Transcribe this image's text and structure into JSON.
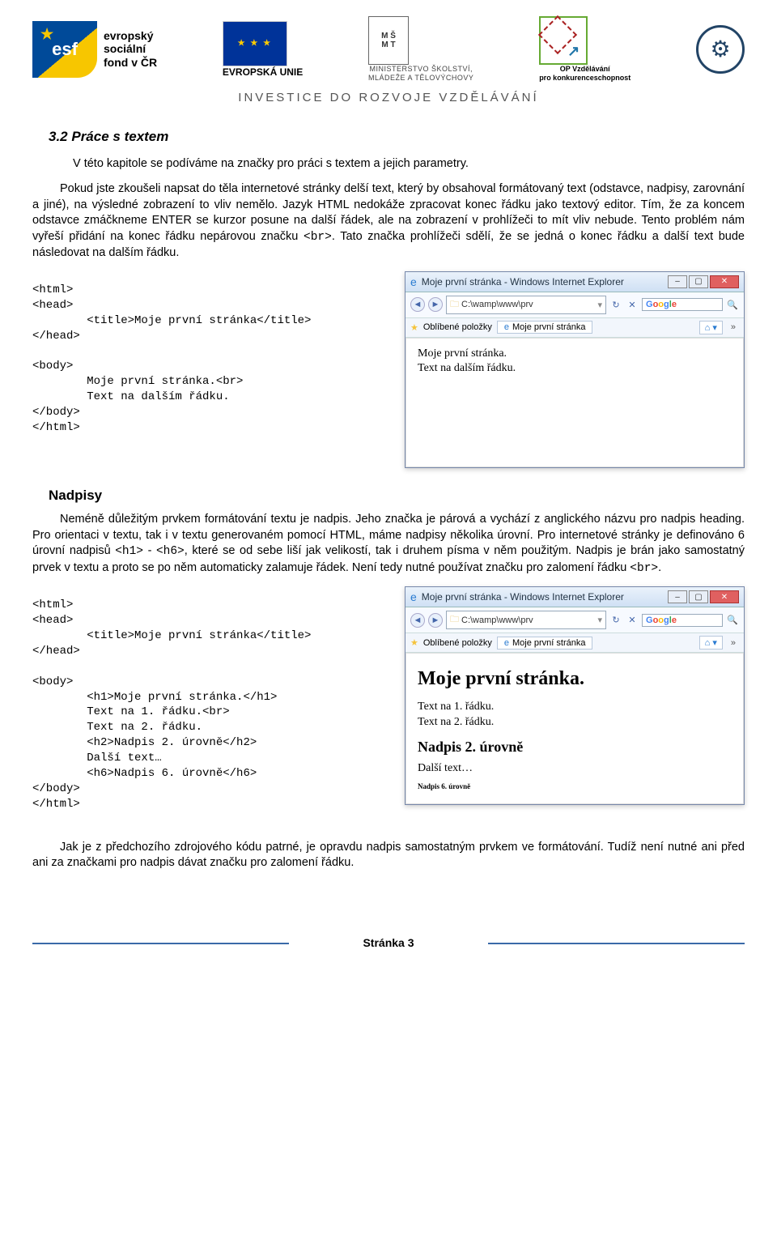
{
  "header": {
    "esf_text": "evropský\nsociální\nfond v ČR",
    "eu_label": "EVROPSKÁ UNIE",
    "msmt_line1": "MINISTERSTVO ŠKOLSTVÍ,",
    "msmt_line2": "MLÁDEŽE A TĚLOVÝCHOVY",
    "op_line1": "OP Vzdělávání",
    "op_line2": "pro konkurenceschopnost",
    "tagline": "INVESTICE DO ROZVOJE VZDĚLÁVÁNÍ"
  },
  "section_title": "3.2 Práce s textem",
  "intro": "V této kapitole se podíváme na značky pro práci s textem a jejich parametry.",
  "para1_a": "Pokud jste zkoušeli napsat do těla internetové stránky delší text, který by obsahoval formátovaný text (odstavce, nadpisy, zarovnání a jiné), na výsledné zobrazení to vliv nemělo. Jazyk HTML nedokáže zpracovat konec řádku jako textový editor. Tím, že za koncem odstavce zmáčkneme ENTER se kurzor posune na další řádek, ale na zobrazení v prohlížeči to mít vliv nebude. Tento problém nám vyřeší přidání na konec řádku nepárovou značku ",
  "para1_code": "<br>",
  "para1_b": ".  Tato značka prohlížeči sdělí, že se jedná o konec řádku a další text bude následovat na dalším řádku.",
  "code1": "<html>\n<head>\n        <title>Moje první stránka</title>\n</head>\n\n<body>\n        Moje první stránka.<br>\n        Text na dalším řádku.\n</body>\n</html>",
  "browser1": {
    "title": "Moje první stránka - Windows Internet Explorer",
    "url": "C:\\wamp\\www\\prv",
    "search": "Google",
    "fav_label": "Oblíbené položky",
    "tab_label": "Moje první stránka",
    "line1": "Moje první stránka.",
    "line2": "Text na dalším řádku."
  },
  "heading2": "Nadpisy",
  "para2_a": "Neméně důležitým prvkem formátování textu je nadpis. Jeho značka je párová a vychází z anglického názvu pro nadpis heading. Pro orientaci v textu, tak i v textu generovaném pomocí HTML, máme nadpisy několika úrovní. Pro internetové stránky je definováno 6 úrovní nadpisů ",
  "para2_code1": "<h1>",
  "para2_mid": " - ",
  "para2_code2": "<h6>",
  "para2_b": ", které se od sebe liší jak velikostí, tak i druhem písma v něm použitým. Nadpis je brán jako samostatný prvek v textu a proto se po něm automaticky zalamuje řádek. Není tedy nutné používat značku pro zalomení řádku ",
  "para2_code3": "<br>",
  "para2_c": ".",
  "code2": "<html>\n<head>\n        <title>Moje první stránka</title>\n</head>\n\n<body>\n        <h1>Moje první stránka.</h1>\n        Text na 1. řádku.<br>\n        Text na 2. řádku.\n        <h2>Nadpis 2. úrovně</h2>\n        Další text…\n        <h6>Nadpis 6. úrovně</h6>\n</body>\n</html>",
  "browser2": {
    "title": "Moje první stránka - Windows Internet Explorer",
    "url": "C:\\wamp\\www\\prv",
    "search": "Google",
    "fav_label": "Oblíbené položky",
    "tab_label": "Moje první stránka",
    "h1": "Moje první stránka.",
    "l1": "Text na 1. řádku.",
    "l2": "Text na 2. řádku.",
    "h2": "Nadpis 2. úrovně",
    "l3": "Další text…",
    "h6": "Nadpis 6. úrovně"
  },
  "para3": "Jak je z předchozího zdrojového kódu patrné, je opravdu nadpis samostatným prvkem ve formátování. Tudíž není nutné ani před ani za značkami pro nadpis dávat značku pro zalomení řádku.",
  "footer": "Stránka 3"
}
